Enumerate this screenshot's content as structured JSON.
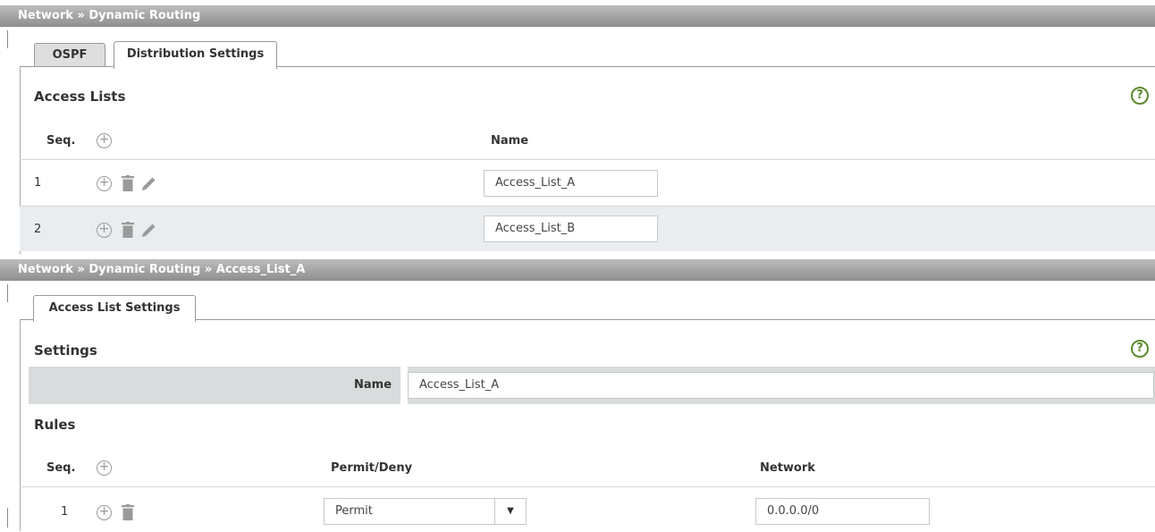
{
  "top": {
    "breadcrumb": "Network » Dynamic Routing",
    "tabs": [
      {
        "label": "OSPF",
        "active": false
      },
      {
        "label": "Distribution Settings",
        "active": true
      }
    ],
    "section_title": "Access Lists",
    "help_symbol": "?",
    "columns": {
      "seq": "Seq.",
      "name": "Name"
    },
    "rows": [
      {
        "seq": "1",
        "name": "Access_List_A"
      },
      {
        "seq": "2",
        "name": "Access_List_B"
      }
    ]
  },
  "bottom": {
    "breadcrumb": "Network » Dynamic Routing » Access_List_A",
    "tab": "Access List Settings",
    "settings_title": "Settings",
    "help_symbol": "?",
    "name_label": "Name",
    "name_value": "Access_List_A",
    "rules_title": "Rules",
    "columns": {
      "seq": "Seq.",
      "permit_deny": "Permit/Deny",
      "network": "Network"
    },
    "rules": [
      {
        "seq": "1",
        "permit_deny": "Permit",
        "network": "0.0.0.0/0"
      }
    ]
  },
  "icons": {
    "plus": "+",
    "dropdown": "▼"
  },
  "colors": {
    "breadcrumb_bar": "#9e9e9e",
    "help_icon": "#5a8a2c",
    "alt_row": "#e9edf0",
    "name_row": "#d8dcdc"
  }
}
